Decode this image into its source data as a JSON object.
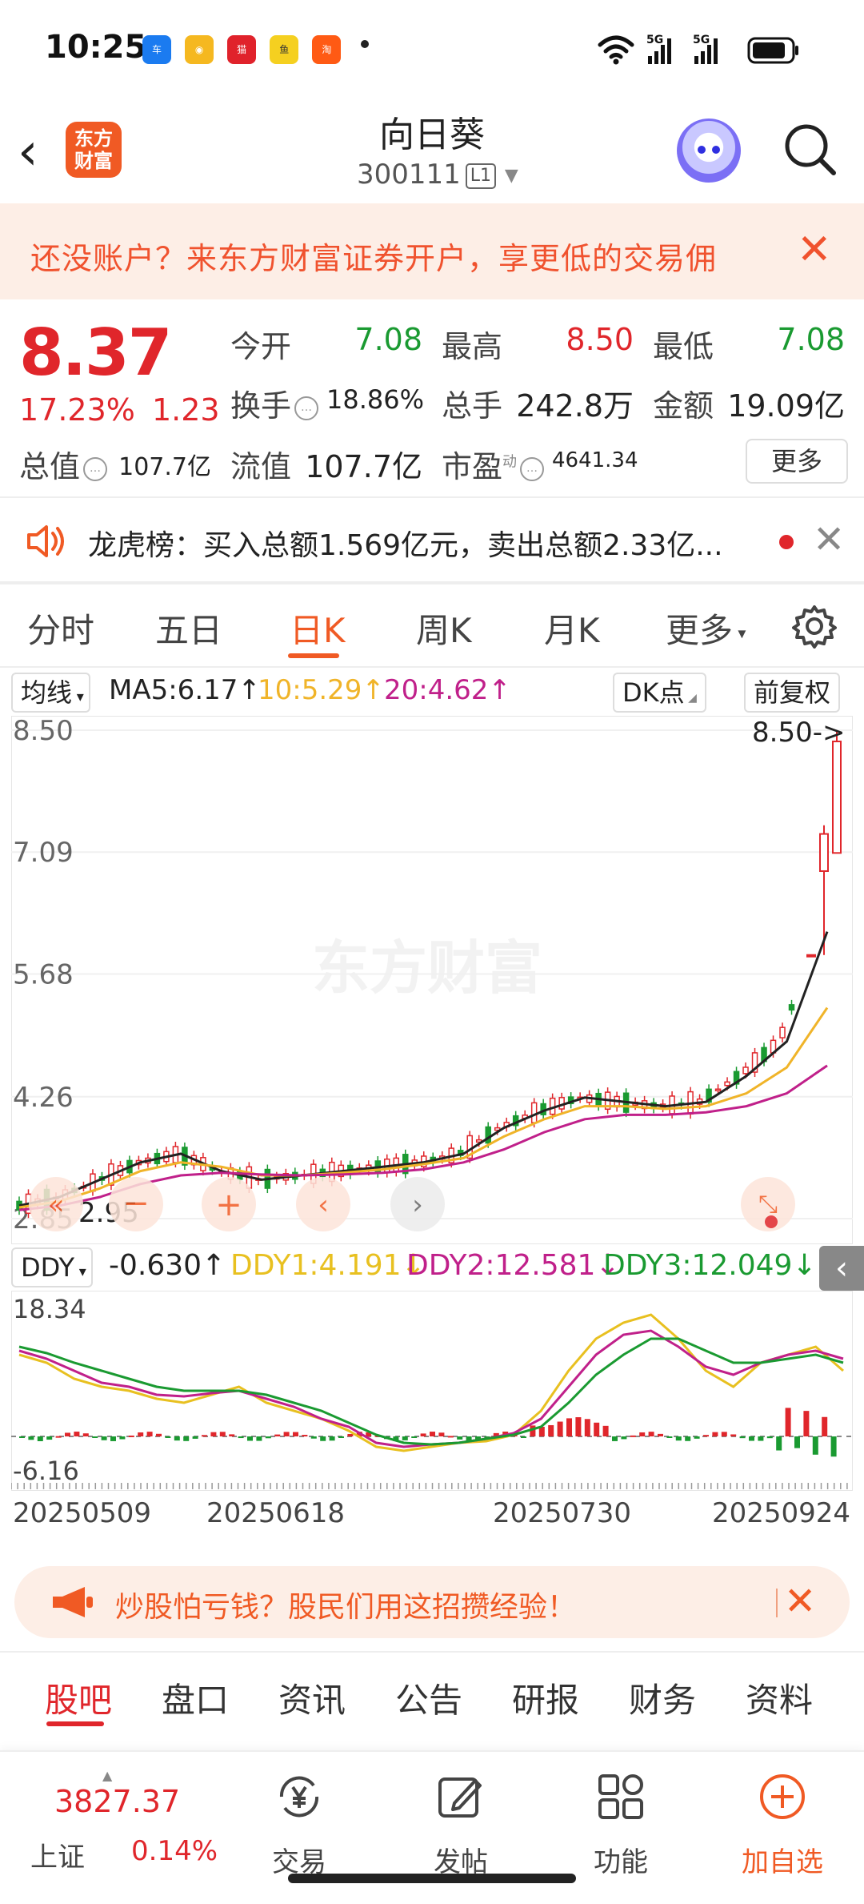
{
  "status_bar": {
    "time": "10:25",
    "app_icons": [
      {
        "name": "autohome-app-icon",
        "label": "汽车之家",
        "color": "#1b7bf0"
      },
      {
        "name": "weibo-app-icon",
        "label": "微博",
        "color": "#f5b820"
      },
      {
        "name": "tmall-app-icon",
        "label": "天猫",
        "color": "#e0222b"
      },
      {
        "name": "xianyu-app-icon",
        "label": "咸鱼",
        "color": "#f5d020"
      },
      {
        "name": "taobao-app-icon",
        "label": "淘",
        "color": "#ff5a14"
      }
    ],
    "network": [
      "5G",
      "5G"
    ]
  },
  "header": {
    "logo_text": "东方财富",
    "name": "向日葵",
    "code": "300111",
    "level": "L1"
  },
  "banner": {
    "text": "还没账户？来东方财富证券开户，享更低的交易佣"
  },
  "quote": {
    "price": "8.37",
    "change_pct": "17.23%",
    "change": "1.23",
    "open_label": "今开",
    "open": "7.08",
    "high_label": "最高",
    "high": "8.50",
    "low_label": "最低",
    "low": "7.08",
    "turnover_label": "换手",
    "turnover": "18.86%",
    "volume_label": "总手",
    "volume": "242.8万",
    "amount_label": "金额",
    "amount": "19.09亿",
    "mktcap_label": "总值",
    "mktcap": "107.7亿",
    "float_label": "流值",
    "float": "107.7亿",
    "pe_label": "市盈",
    "pe_sup": "动",
    "pe": "4641.34",
    "more": "更多"
  },
  "dragon": {
    "text": "龙虎榜：买入总额1.569亿元，卖出总额2.33亿..."
  },
  "chart_tabs": [
    "分时",
    "五日",
    "日K",
    "周K",
    "月K",
    "更多"
  ],
  "ma_row": {
    "selector": "均线",
    "ma5": "MA5:6.17↑",
    "ma10": "10:5.29↑",
    "ma20": "20:4.62↑",
    "dk": "DK点",
    "adjust": "前复权"
  },
  "chart_data": [
    {
      "type": "candlestick",
      "y_axis_ticks": [
        "8.50",
        "7.09",
        "5.68",
        "4.26",
        "2.85"
      ],
      "ylim": [
        2.85,
        8.5
      ],
      "max_marker": "8.50->",
      "min_marker": "2.95",
      "watermark": "东方财富",
      "series": [
        {
          "name": "MA5",
          "color": "#222222",
          "values": [
            3.0,
            3.1,
            3.3,
            3.5,
            3.6,
            3.4,
            3.3,
            3.35,
            3.4,
            3.45,
            3.5,
            3.6,
            3.9,
            4.1,
            4.25,
            4.2,
            4.15,
            4.2,
            4.5,
            4.9,
            6.17
          ]
        },
        {
          "name": "MA10",
          "color": "#f0b429",
          "values": [
            2.98,
            3.05,
            3.2,
            3.4,
            3.5,
            3.45,
            3.35,
            3.35,
            3.38,
            3.42,
            3.48,
            3.55,
            3.8,
            4.0,
            4.15,
            4.15,
            4.12,
            4.15,
            4.3,
            4.6,
            5.29
          ]
        },
        {
          "name": "MA20",
          "color": "#c0208a",
          "values": [
            2.95,
            3.0,
            3.1,
            3.25,
            3.35,
            3.38,
            3.36,
            3.35,
            3.36,
            3.38,
            3.42,
            3.5,
            3.65,
            3.85,
            4.0,
            4.05,
            4.05,
            4.08,
            4.15,
            4.3,
            4.62
          ]
        }
      ],
      "last_candles": [
        {
          "open": 5.9,
          "close": 5.9,
          "high": 5.9,
          "low": 5.9
        },
        {
          "open": 6.87,
          "close": 7.3,
          "high": 7.4,
          "low": 5.9
        },
        {
          "open": 7.08,
          "close": 8.37,
          "high": 8.5,
          "low": 7.08
        }
      ]
    },
    {
      "type": "line",
      "indicator": "DDY",
      "ddy": "-0.630↑",
      "ddy1": "DDY1:4.191↓",
      "ddy2": "DDY2:12.581↓",
      "ddy3": "DDY3:12.049↓",
      "y_axis_ticks": [
        "18.34",
        "-6.16"
      ],
      "ylim": [
        -6.16,
        18.34
      ],
      "x_ticks": [
        "20250509",
        "20250618",
        "20250730",
        "20250924"
      ],
      "series": [
        {
          "name": "DDY1",
          "color": "#e8c020"
        },
        {
          "name": "DDY2",
          "color": "#c0208a"
        },
        {
          "name": "DDY3",
          "color": "#1a9a31"
        }
      ]
    }
  ],
  "promo": {
    "text": "炒股怕亏钱？股民们用这招攒经验！"
  },
  "bottom_tabs": [
    "股吧",
    "盘口",
    "资讯",
    "公告",
    "研报",
    "财务",
    "资料"
  ],
  "bottom_nav": {
    "index_value": "3827.37",
    "index_name": "上证",
    "index_pct": "0.14%",
    "items": [
      "交易",
      "发帖",
      "功能",
      "加自选"
    ]
  },
  "colors": {
    "accent": "#f05a24",
    "up": "#e0262b",
    "down": "#1a9a31"
  }
}
